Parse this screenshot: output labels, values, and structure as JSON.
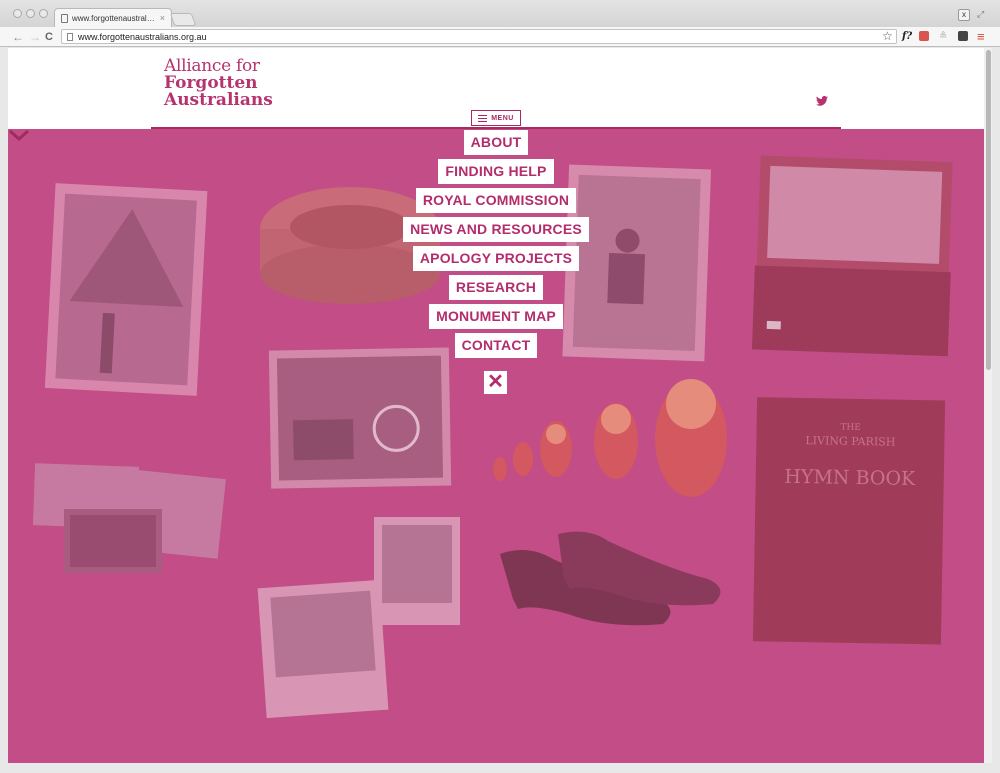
{
  "browser": {
    "tab_title": "www.forgottenaustralians.",
    "tab_close": "×",
    "url": "www.forgottenaustralians.org.au",
    "window_close": "x",
    "back_glyph": "←",
    "forward_glyph": "→",
    "reload_glyph": "C",
    "star_glyph": "☆",
    "ext_f_glyph": "f?",
    "menu_glyph": "≡"
  },
  "site": {
    "logo": {
      "line1": "Alliance for",
      "line2": "Forgotten",
      "line3": "Australians"
    },
    "menu_label": "MENU",
    "menu_items": [
      "ABOUT",
      "FINDING HELP",
      "ROYAL COMMISSION",
      "NEWS AND RESOURCES",
      "APOLOGY PROJECTS",
      "RESEARCH",
      "MONUMENT MAP",
      "CONTACT"
    ],
    "close_glyph": "✕",
    "hymn_book": {
      "line1": "THE",
      "line2": "LIVING PARISH",
      "line3": "HYMN BOOK"
    }
  },
  "colors": {
    "brand": "#b5346f",
    "overlay": "#c24d87"
  }
}
